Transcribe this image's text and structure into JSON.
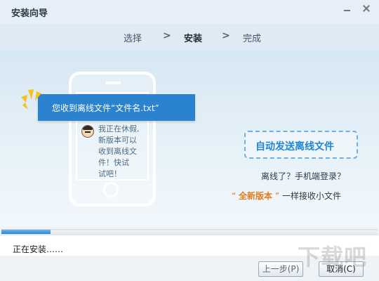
{
  "window": {
    "title": "安装向导"
  },
  "steps": [
    {
      "label": "选择"
    },
    {
      "label": "安装"
    },
    {
      "label": "完成"
    }
  ],
  "step_separator": ">",
  "banner": {
    "notification": "您收到离线文件“文件名.txt”",
    "chat_message_lines": [
      "我正在休假,",
      "新版本可以",
      "收到离线文",
      "件！快试",
      "试吧！"
    ],
    "feature_button": "自动发送离线文件",
    "offline_question": "离线了？手机端登录？",
    "new_version": {
      "open_quote": "“",
      "label": "全新版本",
      "close_quote": "”",
      "suffix": "一样接收小文件"
    }
  },
  "progress": {
    "value": 0.13
  },
  "status_text": "正在安装……",
  "buttons": {
    "prev": "上一步(P)",
    "cancel": "取消(C)"
  },
  "watermark": "下载吧",
  "colors": {
    "accent": "#2b82cf",
    "highlight": "#e27b1a",
    "feature_text": "#1f86d4"
  }
}
